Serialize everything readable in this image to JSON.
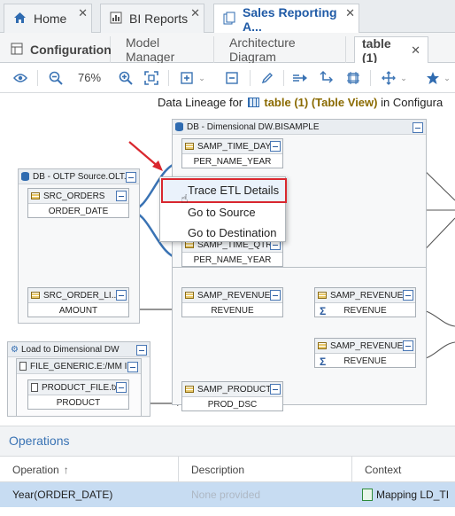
{
  "app_tabs": [
    {
      "label": "Home",
      "icon": "home-icon"
    },
    {
      "label": "BI Reports",
      "icon": "report-icon"
    },
    {
      "label": "Sales Reporting A...",
      "icon": "document-icon"
    }
  ],
  "sub_tabs": [
    "Configuration",
    "Model Manager",
    "Architecture Diagram",
    "table (1)"
  ],
  "toolbar": {
    "zoom": "76%"
  },
  "lineage": {
    "prefix": "Data Lineage for",
    "entity": "table (1) (Table View)",
    "suffix": "in Configura"
  },
  "groups": {
    "dw": "DB - Dimensional DW.BISAMPLE",
    "oltp": "DB - OLTP Source.OLT...",
    "load": "Load to Dimensional DW",
    "file": "FILE_GENERIC.E:/MM I..."
  },
  "nodes": {
    "src_orders": {
      "title": "SRC_ORDERS",
      "field": "ORDER_DATE"
    },
    "src_order_li": {
      "title": "SRC_ORDER_LI...",
      "field": "AMOUNT"
    },
    "product_file": {
      "title": "PRODUCT_FILE.txt",
      "field": "PRODUCT"
    },
    "samp_time_day": {
      "title": "SAMP_TIME_DAY...",
      "field": "PER_NAME_YEAR"
    },
    "samp_time_qtr": {
      "title": "SAMP_TIME_QTR...",
      "field": "PER_NAME_YEAR"
    },
    "samp_revenue": {
      "title": "SAMP_REVENUE...",
      "field": "REVENUE"
    },
    "samp_product": {
      "title": "SAMP_PRODUCT...",
      "field": "PROD_DSC"
    },
    "samp_revenue_a": {
      "title": "SAMP_REVENUE...",
      "field": "REVENUE"
    },
    "samp_revenue_b": {
      "title": "SAMP_REVENUE...",
      "field": "REVENUE"
    }
  },
  "context_menu": [
    "Trace ETL Details",
    "Go to Source",
    "Go to Destination"
  ],
  "operations": {
    "title": "Operations",
    "columns": [
      "Operation",
      "Description",
      "Context"
    ],
    "sort_icon": "sort-ascending-icon",
    "rows": [
      {
        "operation": "Year(ORDER_DATE)",
        "description": "None provided",
        "context": "Mapping LD_TI"
      }
    ]
  },
  "colors": {
    "accent": "#1f5aa6",
    "highlight": "#d9272e",
    "selected_row": "#c7dcf2"
  }
}
